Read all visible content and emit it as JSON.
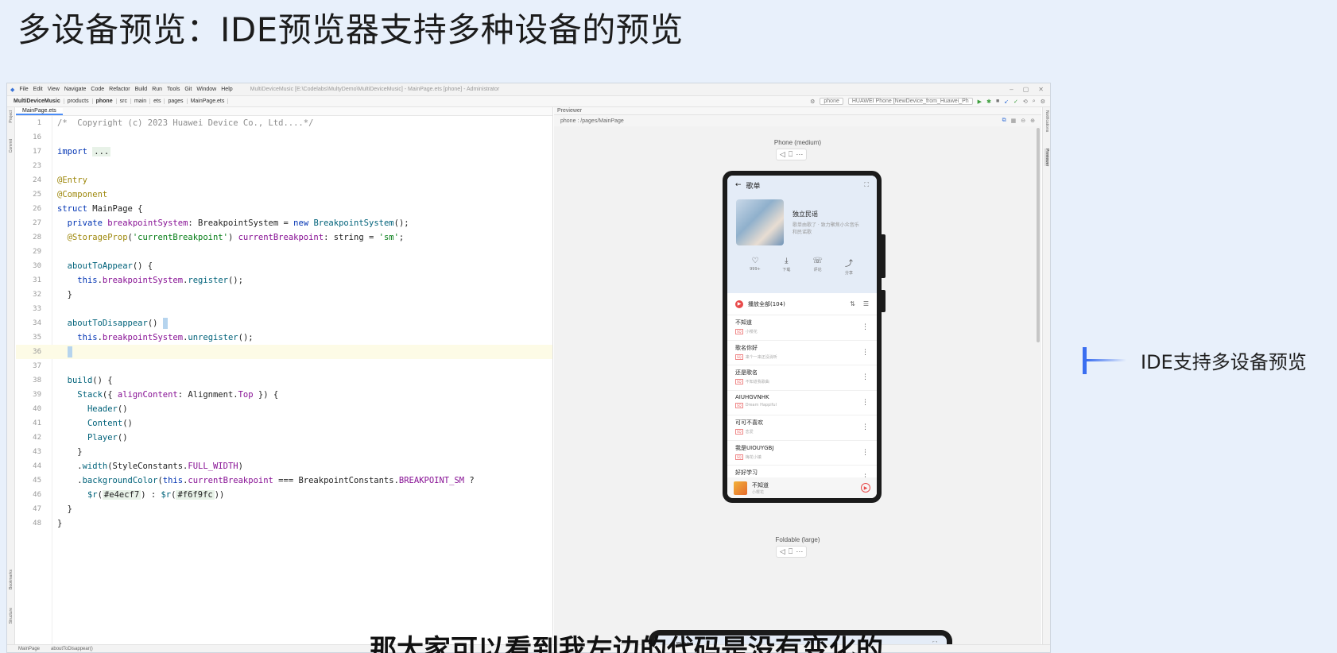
{
  "slide": {
    "title": "多设备预览：IDE预览器支持多种设备的预览",
    "callout": "IDE支持多设备预览",
    "subtitle": "那大家可以看到我左边的代码是没有变化的"
  },
  "ide": {
    "menu": [
      "File",
      "Edit",
      "View",
      "Navigate",
      "Code",
      "Refactor",
      "Build",
      "Run",
      "Tools",
      "Git",
      "Window",
      "Help"
    ],
    "window_title": "MultiDeviceMusic [E:\\Codelabs\\MultyDemo\\MultiDeviceMusic] - MainPage.ets [phone] - Administrator",
    "breadcrumbs": [
      "MultiDeviceMusic",
      "products",
      "phone",
      "src",
      "main",
      "ets",
      "pages",
      "MainPage.ets"
    ],
    "run_config": "phone",
    "device_select": "HUAWEI Phone [NewDevice_from_Huawei_Ph",
    "editor_tab": "MainPage.ets",
    "status_path": [
      "MainPage",
      "aboutToDisappear()"
    ],
    "left_strip": [
      "Project",
      "Commit",
      "Bookmarks",
      "Structure"
    ],
    "right_strip": [
      "Notifications",
      "Previewer"
    ]
  },
  "code_lines": [
    {
      "n": "1",
      "html": "<span class=\"cm\">/*  Copyright (c) 2023 Huawei Device Co., Ltd....*/</span>"
    },
    {
      "n": "16",
      "html": ""
    },
    {
      "n": "17",
      "html": "<span class=\"kw\">import</span> <span class=\"fold\">...</span>"
    },
    {
      "n": "23",
      "html": ""
    },
    {
      "n": "24",
      "html": "<span class=\"an\">@Entry</span>"
    },
    {
      "n": "25",
      "html": "<span class=\"an\">@Component</span>"
    },
    {
      "n": "26",
      "html": "<span class=\"kw\">struct</span> MainPage {"
    },
    {
      "n": "27",
      "html": "  <span class=\"kw\">private</span> <span class=\"pr\">breakpointSystem</span>: BreakpointSystem = <span class=\"kw\">new</span> <span class=\"fn\">BreakpointSystem</span>();"
    },
    {
      "n": "28",
      "html": "  <span class=\"an\">@StorageProp</span>(<span class=\"st\">'currentBreakpoint'</span>) <span class=\"pr\">currentBreakpoint</span>: string = <span class=\"st\">'sm'</span>;"
    },
    {
      "n": "29",
      "html": ""
    },
    {
      "n": "30",
      "html": "  <span class=\"fn\">aboutToAppear</span>() {"
    },
    {
      "n": "31",
      "html": "    <span class=\"kw\">this</span>.<span class=\"pr\">breakpointSystem</span>.<span class=\"fn\">register</span>();"
    },
    {
      "n": "32",
      "html": "  }"
    },
    {
      "n": "33",
      "html": ""
    },
    {
      "n": "34",
      "html": "  <span class=\"fn\">aboutToDisappear</span>() <span class=\"caret\"></span>"
    },
    {
      "n": "35",
      "html": "    <span class=\"kw\">this</span>.<span class=\"pr\">breakpointSystem</span>.<span class=\"fn\">unregister</span>();"
    },
    {
      "n": "36",
      "html": "  <span class=\"caret\"></span>",
      "current": true
    },
    {
      "n": "37",
      "html": ""
    },
    {
      "n": "38",
      "html": "  <span class=\"fn\">build</span>() {"
    },
    {
      "n": "39",
      "html": "    <span class=\"fn\">Stack</span>({ <span class=\"pr\">alignContent</span>: Alignment.<span class=\"pr\">Top</span> }) {"
    },
    {
      "n": "40",
      "html": "      <span class=\"fn\">Header</span>()"
    },
    {
      "n": "41",
      "html": "      <span class=\"fn\">Content</span>()"
    },
    {
      "n": "42",
      "html": "      <span class=\"fn\">Player</span>()"
    },
    {
      "n": "43",
      "html": "    }"
    },
    {
      "n": "44",
      "html": "    .<span class=\"fn\">width</span>(StyleConstants.<span class=\"pr\">FULL_WIDTH</span>)"
    },
    {
      "n": "45",
      "html": "    .<span class=\"fn\">backgroundColor</span>(<span class=\"kw\">this</span>.<span class=\"pr\">currentBreakpoint</span> === BreakpointConstants.<span class=\"pr\">BREAKPOINT_SM</span> ?"
    },
    {
      "n": "46",
      "html": "      <span class=\"fn\">$r</span>(<span class=\"fold\">#e4ecf7</span>) : <span class=\"fn\">$r</span>(<span class=\"fold\">#f6f9fc</span>))"
    },
    {
      "n": "47",
      "html": "  }"
    },
    {
      "n": "48",
      "html": "}"
    }
  ],
  "previewer": {
    "header": "Previewer",
    "path": "phone : /pages/MainPage",
    "device1_label": "Phone (medium)",
    "device2_label": "Foldable (large)",
    "app": {
      "nav_title": "歌单",
      "album_title": "独立民谣",
      "album_desc": "歌单由歌了 · 致力聚焦小众音乐和民谣歌",
      "actions": [
        {
          "icon": "♡",
          "label": "999+"
        },
        {
          "icon": "⤓",
          "label": "下载"
        },
        {
          "icon": "☏",
          "label": "评论"
        },
        {
          "icon": "⤴",
          "label": "分享"
        }
      ],
      "play_all": "播放全部(104)",
      "songs": [
        {
          "name": "不知道",
          "sub": "小樱花"
        },
        {
          "name": "歌名你好",
          "sub": "来个一来还没消听"
        },
        {
          "name": "还是歌名",
          "sub": "不知道我歌曲"
        },
        {
          "name": "AIUHGVNHK",
          "sub": "Dream Happiful"
        },
        {
          "name": "可可不喜欢",
          "sub": "恋爱"
        },
        {
          "name": "我是UIOUYGBJ",
          "sub": "梅花小镇"
        },
        {
          "name": "好好学习",
          "sub": ""
        }
      ],
      "player_title": "不知道",
      "player_sub": "小樱花"
    }
  }
}
